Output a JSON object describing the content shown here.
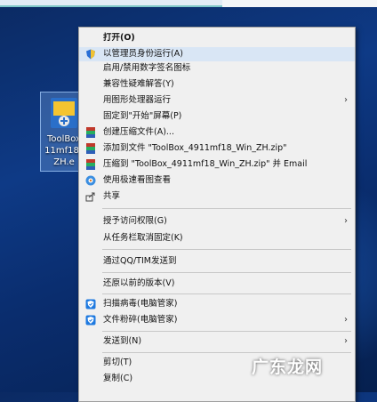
{
  "desktop_icon": {
    "label": "ToolBox\n11mf18_\nZH.e"
  },
  "menu": {
    "items": [
      {
        "label": "打开(O)",
        "icon": "none",
        "bold": true
      },
      {
        "label": "以管理员身份运行(A)",
        "icon": "shield-icon",
        "highlighted": true
      },
      {
        "label": "启用/禁用数字签名图标",
        "icon": "none"
      },
      {
        "label": "兼容性疑难解答(Y)",
        "icon": "none"
      },
      {
        "label": "用图形处理器运行",
        "icon": "none",
        "submenu": true
      },
      {
        "label": "固定到\"开始\"屏幕(P)",
        "icon": "none"
      },
      {
        "label": "创建压缩文件(A)...",
        "icon": "winrar-icon"
      },
      {
        "label": "添加到文件 \"ToolBox_4911mf18_Win_ZH.zip\"",
        "icon": "winrar-icon"
      },
      {
        "label": "压缩到 \"ToolBox_4911mf18_Win_ZH.zip\" 并 Email",
        "icon": "winrar-icon"
      },
      {
        "label": "使用极速看图查看",
        "icon": "photo-viewer-icon"
      },
      {
        "label": "共享",
        "icon": "share-icon"
      },
      {
        "label": "授予访问权限(G)",
        "icon": "none",
        "submenu": true
      },
      {
        "label": "从任务栏取消固定(K)",
        "icon": "none"
      },
      {
        "label": "通过QQ/TIM发送到",
        "icon": "none"
      },
      {
        "label": "还原以前的版本(V)",
        "icon": "none"
      },
      {
        "label": "扫描病毒(电脑管家)",
        "icon": "pc-manager-icon"
      },
      {
        "label": "文件粉碎(电脑管家)",
        "icon": "pc-manager-icon",
        "submenu": true
      },
      {
        "label": "发送到(N)",
        "icon": "none",
        "submenu": true
      },
      {
        "label": "剪切(T)",
        "icon": "none"
      },
      {
        "label": "复制(C)",
        "icon": "none"
      }
    ],
    "submenu_arrow": "›"
  },
  "watermark": "广东龙网",
  "colors": {
    "highlight": "#d9e6f5",
    "menu_bg": "#f0f0f0"
  }
}
